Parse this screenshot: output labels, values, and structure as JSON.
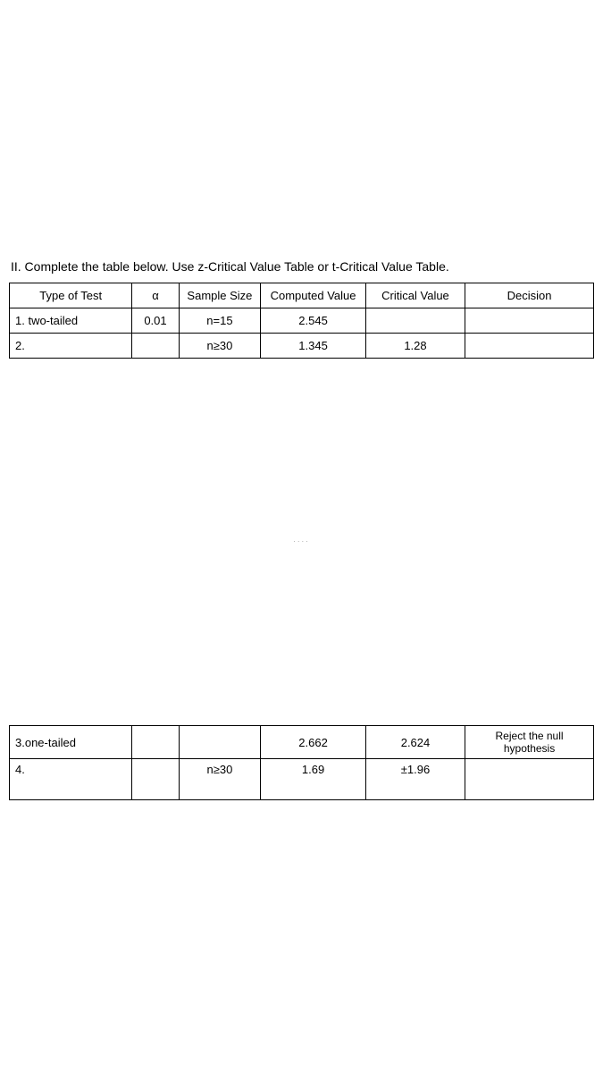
{
  "instruction": "II. Complete the table below. Use z-Critical Value Table or t-Critical Value Table.",
  "headers": {
    "type_of_test": "Type of Test",
    "alpha": "α",
    "sample_size": "Sample Size",
    "computed_value": "Computed Value",
    "critical_value": "Critical Value",
    "decision": "Decision"
  },
  "rows": {
    "r1": {
      "type": "1. two-tailed",
      "alpha": "0.01",
      "sample": "n=15",
      "computed": "2.545",
      "critical": "",
      "decision": ""
    },
    "r2": {
      "type": "2.",
      "alpha": "",
      "sample": "n≥30",
      "computed": "1.345",
      "critical": "1.28",
      "decision": ""
    },
    "r3": {
      "type": "3.one-tailed",
      "alpha": "",
      "sample": "",
      "computed": "2.662",
      "critical": "2.624",
      "decision": "Reject the null hypothesis"
    },
    "r4": {
      "type": "4.",
      "alpha": "",
      "sample": "n≥30",
      "computed": "1.69",
      "critical": "±1.96",
      "decision": ""
    }
  },
  "break_hint": "····"
}
